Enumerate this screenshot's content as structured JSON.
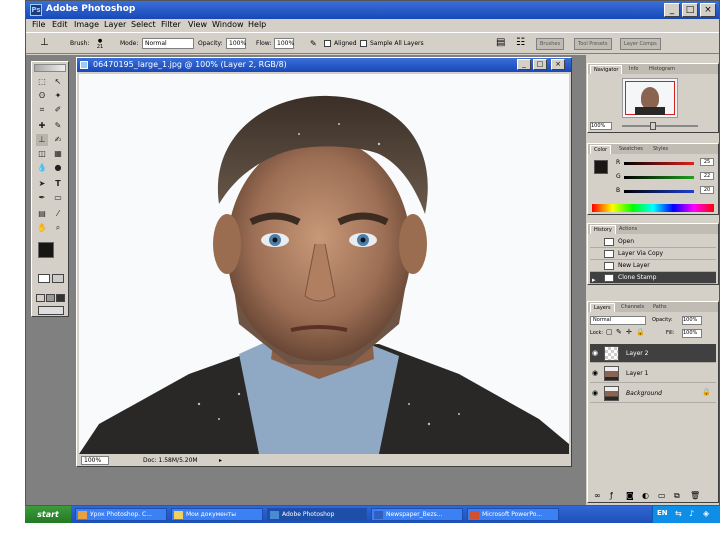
{
  "app": {
    "title": "Adobe Photoshop",
    "logo": "Ps"
  },
  "window_buttons": {
    "minimize": "_",
    "maximize": "□",
    "close": "×"
  },
  "menu": [
    "File",
    "Edit",
    "Image",
    "Layer",
    "Select",
    "Filter",
    "View",
    "Window",
    "Help"
  ],
  "options_bar": {
    "brush_label": "Brush:",
    "brush_size": "21",
    "mode_label": "Mode:",
    "mode_value": "Normal",
    "opacity_label": "Opacity:",
    "opacity_value": "100%",
    "flow_label": "Flow:",
    "flow_value": "100%",
    "aligned_label": "Aligned",
    "sample_all_label": "Sample All Layers",
    "tabs": [
      "Brushes",
      "Tool Presets",
      "Layer Comps"
    ]
  },
  "document": {
    "title": "06470195_large_1.jpg @ 100% (Layer 2, RGB/8)",
    "zoom": "100%",
    "doc_info": "Doc: 1.58M/5.20M"
  },
  "navigator": {
    "tabs": [
      "Navigator",
      "Info",
      "Histogram"
    ],
    "zoom": "100%"
  },
  "color_panel": {
    "tabs": [
      "Color",
      "Swatches",
      "Styles"
    ],
    "channels": [
      {
        "label": "R",
        "value": "25",
        "color": "#e02020"
      },
      {
        "label": "G",
        "value": "22",
        "color": "#20a020"
      },
      {
        "label": "B",
        "value": "20",
        "color": "#2040d0"
      }
    ]
  },
  "history_panel": {
    "tabs": [
      "History",
      "Actions"
    ],
    "items": [
      "Open",
      "Layer Via Copy",
      "New Layer",
      "Clone Stamp"
    ]
  },
  "layers_panel": {
    "tabs": [
      "Layers",
      "Channels",
      "Paths"
    ],
    "blend_mode": "Normal",
    "opacity_label": "Opacity:",
    "opacity_value": "100%",
    "lock_label": "Lock:",
    "fill_label": "Fill:",
    "fill_value": "100%",
    "layers": [
      {
        "name": "Layer 2",
        "selected": true
      },
      {
        "name": "Layer 1",
        "selected": false
      },
      {
        "name": "Background",
        "selected": false
      }
    ]
  },
  "taskbar": {
    "start": "start",
    "tasks": [
      {
        "label": "Урок Photoshop. С...",
        "active": false
      },
      {
        "label": "Мои документы",
        "active": false
      },
      {
        "label": "Adobe Photoshop",
        "active": true
      },
      {
        "label": "Newspaper_Bezs...",
        "active": false
      },
      {
        "label": "Microsoft PowerPo...",
        "active": false
      }
    ],
    "tray_language": "EN"
  },
  "colors": {
    "titlebar": "#2458c8",
    "window_bg": "#d4d0c8",
    "workspace_bg": "#808080",
    "selected_layer": "#404040"
  }
}
